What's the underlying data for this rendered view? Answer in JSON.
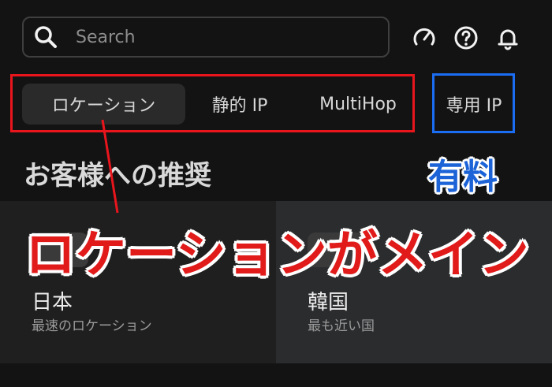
{
  "search": {
    "placeholder": "Search"
  },
  "header_icons": [
    "speedometer-icon",
    "help-icon",
    "bell-icon"
  ],
  "tabs": [
    {
      "label": "ロケーション",
      "active": true
    },
    {
      "label": "静的 IP",
      "active": false
    },
    {
      "label": "MultiHop",
      "active": false
    },
    {
      "label": "専用 IP",
      "active": false
    }
  ],
  "annotations": {
    "paid": "有料",
    "main": "ロケーションがメイン"
  },
  "section": {
    "title": "お客様への推奨"
  },
  "recommendations": [
    {
      "name": "日本",
      "subtitle": "最速のロケーション"
    },
    {
      "name": "韓国",
      "subtitle": "最も近い国"
    }
  ],
  "colors": {
    "accent_red": "#e8151d",
    "accent_blue": "#1b6ef3",
    "background": "#131313"
  }
}
